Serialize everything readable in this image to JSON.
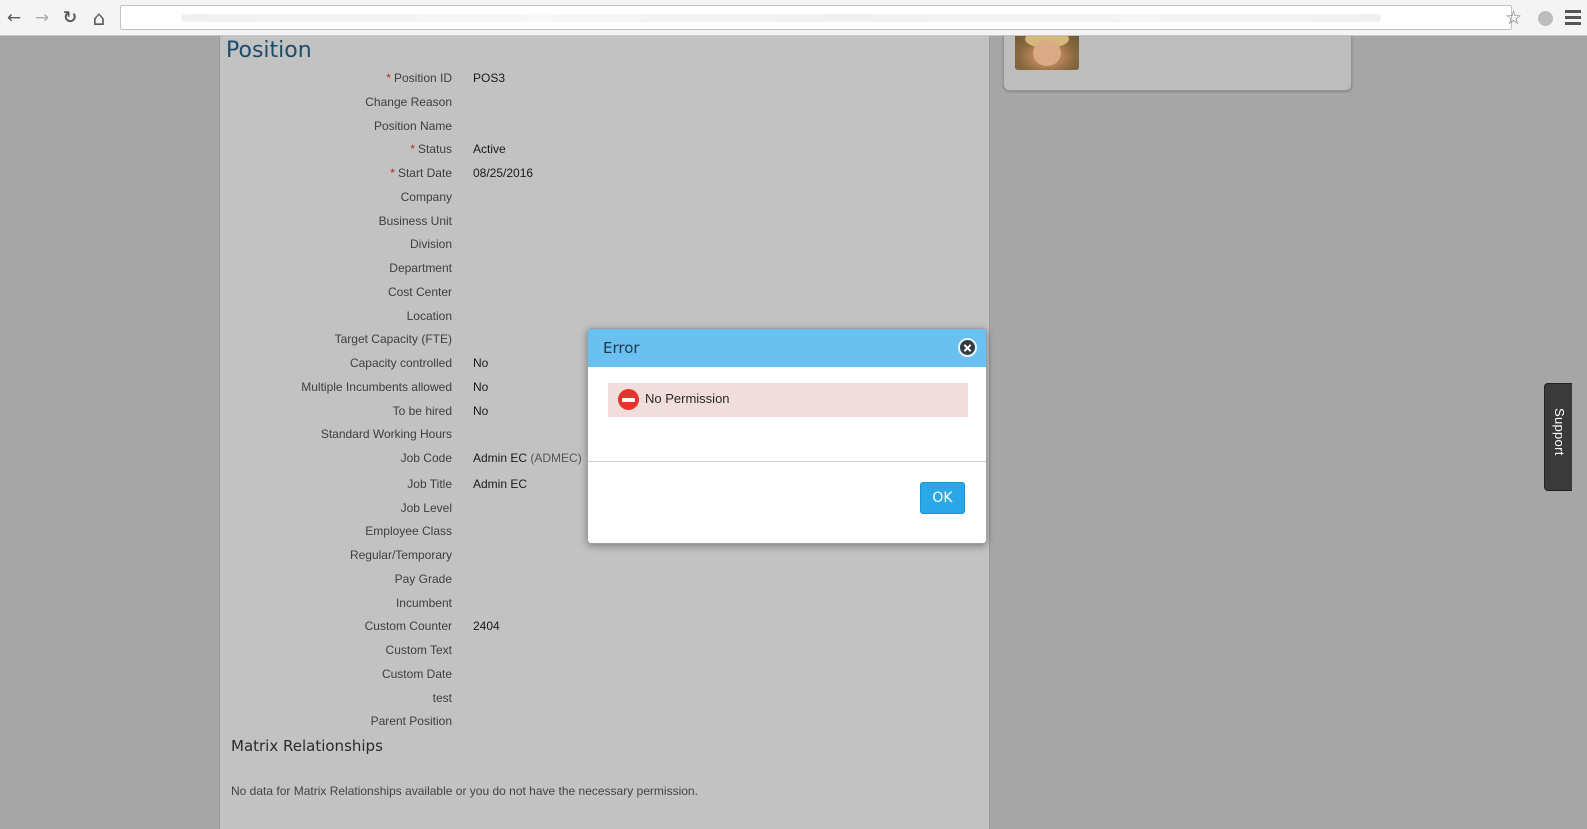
{
  "browser": {
    "back_icon": "←",
    "forward_icon": "→",
    "reload_icon": "↻",
    "home_icon": "⌂",
    "star_icon": "☆"
  },
  "position": {
    "title": "Position",
    "fields": [
      {
        "label": "Position ID",
        "required": true,
        "value": "POS3"
      },
      {
        "label": "Change Reason",
        "required": false,
        "value": ""
      },
      {
        "label": "Position Name",
        "required": false,
        "value": ""
      },
      {
        "label": "Status",
        "required": true,
        "value": "Active"
      },
      {
        "label": "Start Date",
        "required": true,
        "value": "08/25/2016"
      },
      {
        "label": "Company",
        "required": false,
        "value": ""
      },
      {
        "label": "Business Unit",
        "required": false,
        "value": ""
      },
      {
        "label": "Division",
        "required": false,
        "value": ""
      },
      {
        "label": "Department",
        "required": false,
        "value": ""
      },
      {
        "label": "Cost Center",
        "required": false,
        "value": ""
      },
      {
        "label": "Location",
        "required": false,
        "value": ""
      },
      {
        "label": "Target Capacity (FTE)",
        "required": false,
        "value": ""
      },
      {
        "label": "Capacity controlled",
        "required": false,
        "value": "No"
      },
      {
        "label": "Multiple Incumbents allowed",
        "required": false,
        "value": "No"
      },
      {
        "label": "To be hired",
        "required": false,
        "value": "No"
      },
      {
        "label": "Standard Working Hours",
        "required": false,
        "value": ""
      },
      {
        "label": "Job Code",
        "required": false,
        "value": "Admin EC",
        "code": "(ADMEC)"
      },
      {
        "label": "Job Title",
        "required": false,
        "value": "Admin EC"
      },
      {
        "label": "Job Level",
        "required": false,
        "value": ""
      },
      {
        "label": "Employee Class",
        "required": false,
        "value": ""
      },
      {
        "label": "Regular/Temporary",
        "required": false,
        "value": ""
      },
      {
        "label": "Pay Grade",
        "required": false,
        "value": ""
      },
      {
        "label": "Incumbent",
        "required": false,
        "value": ""
      },
      {
        "label": "Custom Counter",
        "required": false,
        "value": "2404"
      },
      {
        "label": "Custom Text",
        "required": false,
        "value": ""
      },
      {
        "label": "Custom Date",
        "required": false,
        "value": ""
      },
      {
        "label": "test",
        "required": false,
        "value": ""
      },
      {
        "label": "Parent Position",
        "required": false,
        "value": ""
      }
    ],
    "required_marker": "*"
  },
  "matrix": {
    "title": "Matrix Relationships",
    "note": "No data for Matrix Relationships available or you do not have the necessary permission."
  },
  "support": {
    "label": "Support"
  },
  "dialog": {
    "title": "Error",
    "message": "No Permission",
    "ok_label": "OK"
  }
}
